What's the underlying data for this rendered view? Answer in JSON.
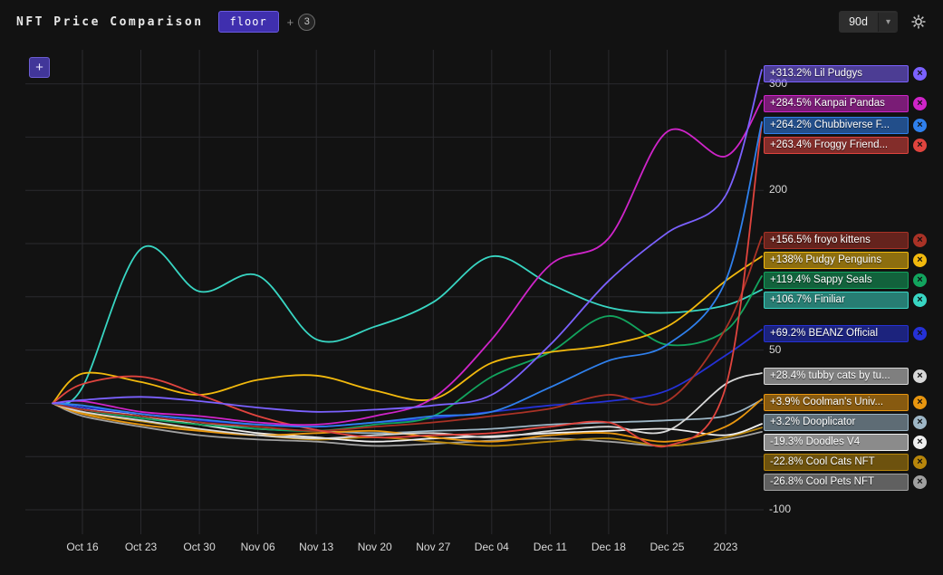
{
  "header": {
    "title": "NFT Price Comparison",
    "metric_button": "floor",
    "plus_sign": "+",
    "more_count": "3",
    "range_button": "90d",
    "add_button": "+"
  },
  "chart_data": {
    "type": "line",
    "title": "NFT Price Comparison (floor, 90d, % change)",
    "x_labels": [
      "Oct 16",
      "Oct 23",
      "Oct 30",
      "Nov 06",
      "Nov 13",
      "Nov 20",
      "Nov 27",
      "Dec 04",
      "Dec 11",
      "Dec 18",
      "Dec 25",
      "2023"
    ],
    "y_tick_labels": [
      300,
      200,
      50,
      -100
    ],
    "y_grid": [
      300,
      250,
      200,
      150,
      100,
      50,
      0,
      -50,
      -100
    ],
    "ylim": [
      -123,
      332
    ],
    "legend_position": "right",
    "series": [
      {
        "name": "Lil Pudgys",
        "pct": "+313.2%",
        "color": "#7b61ff",
        "values": [
          0,
          3,
          6,
          2,
          -4,
          -8,
          -6,
          -2,
          8,
          55,
          115,
          160,
          195,
          313.2
        ]
      },
      {
        "name": "Kanpai Pandas",
        "pct": "+284.5%",
        "color": "#cf24c9",
        "values": [
          0,
          2,
          -8,
          -12,
          -18,
          -20,
          -12,
          5,
          60,
          130,
          155,
          255,
          232,
          284.5
        ]
      },
      {
        "name": "Chubbiverse F...",
        "pct": "+264.2%",
        "color": "#2f80ed",
        "values": [
          0,
          -2,
          -10,
          -15,
          -20,
          -22,
          -18,
          -12,
          -8,
          15,
          40,
          55,
          115,
          264.2
        ]
      },
      {
        "name": "Froggy Friend...",
        "pct": "+263.4%",
        "color": "#e0443e",
        "values": [
          0,
          18,
          25,
          8,
          -12,
          -25,
          -32,
          -30,
          -28,
          -22,
          -18,
          -40,
          15,
          263.4
        ]
      },
      {
        "name": "froyo kittens",
        "pct": "+156.5%",
        "color": "#a93226",
        "values": [
          0,
          -6,
          -12,
          -18,
          -22,
          -26,
          -22,
          -18,
          -12,
          -5,
          8,
          2,
          70,
          156.5
        ]
      },
      {
        "name": "Pudgy Penguins",
        "pct": "+138%",
        "color": "#f2b90d",
        "values": [
          0,
          28,
          20,
          8,
          22,
          26,
          12,
          4,
          38,
          48,
          55,
          72,
          115,
          138
        ]
      },
      {
        "name": "Sappy Seals",
        "pct": "+119.4%",
        "color": "#12a45e",
        "values": [
          0,
          -6,
          -14,
          -20,
          -24,
          -26,
          -20,
          -12,
          25,
          48,
          82,
          55,
          68,
          119.4
        ]
      },
      {
        "name": "Finiliar",
        "pct": "+106.7%",
        "color": "#38d6c3",
        "values": [
          0,
          15,
          145,
          105,
          120,
          60,
          72,
          95,
          138,
          112,
          90,
          85,
          92,
          106.7
        ]
      },
      {
        "name": "BEANZ Official",
        "pct": "+69.2%",
        "color": "#2531d6",
        "values": [
          0,
          -4,
          -10,
          -16,
          -20,
          -22,
          -18,
          -14,
          -8,
          -2,
          2,
          12,
          45,
          69.2
        ]
      },
      {
        "name": "tubby cats by tu...",
        "pct": "+28.4%",
        "color": "#d8d8d8",
        "values": [
          0,
          -8,
          -16,
          -24,
          -30,
          -33,
          -30,
          -28,
          -32,
          -26,
          -22,
          -26,
          18,
          28.4
        ]
      },
      {
        "name": "Coolman's Univ...",
        "pct": "+3.9%",
        "color": "#e8960f",
        "values": [
          0,
          -10,
          -20,
          -26,
          -30,
          -28,
          -26,
          -32,
          -36,
          -30,
          -28,
          -36,
          -22,
          3.9
        ]
      },
      {
        "name": "Dooplicator",
        "pct": "+3.2%",
        "color": "#9db6c6",
        "values": [
          0,
          -6,
          -12,
          -18,
          -24,
          -26,
          -28,
          -26,
          -24,
          -20,
          -18,
          -16,
          -12,
          3.2
        ]
      },
      {
        "name": "Doodles V4",
        "pct": "-19.3%",
        "color": "#efefef",
        "values": [
          0,
          -4,
          -12,
          -20,
          -28,
          -32,
          -36,
          -33,
          -31,
          -28,
          -26,
          -24,
          -30,
          -19.3
        ]
      },
      {
        "name": "Cool Cats NFT",
        "pct": "-22.8%",
        "color": "#b8860b",
        "values": [
          0,
          -9,
          -17,
          -25,
          -30,
          -34,
          -32,
          -36,
          -40,
          -36,
          -33,
          -40,
          -32,
          -22.8
        ]
      },
      {
        "name": "Cool Pets NFT",
        "pct": "-26.8%",
        "color": "#a0a0a0",
        "values": [
          0,
          -12,
          -22,
          -30,
          -34,
          -36,
          -40,
          -38,
          -35,
          -33,
          -36,
          -40,
          -34,
          -26.8
        ]
      }
    ]
  }
}
